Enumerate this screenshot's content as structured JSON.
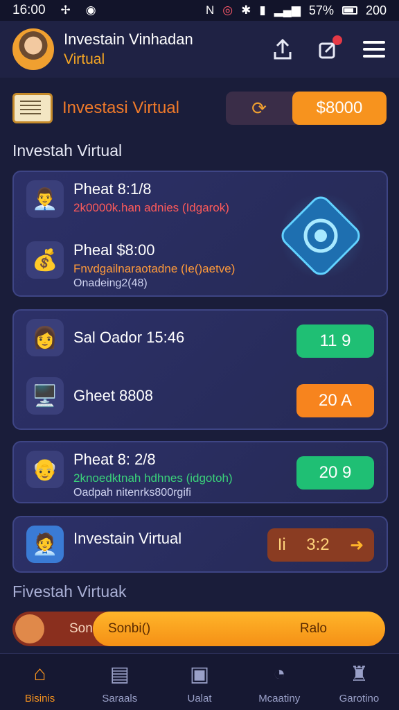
{
  "status_bar": {
    "time": "16:00",
    "battery_text": "57%",
    "right_time": "200"
  },
  "header": {
    "title": "Investain Vinhadan",
    "subtitle": "Virtual"
  },
  "balance": {
    "label": "Investasi Virtual",
    "amount": "$8000"
  },
  "section1": {
    "title": "Investah Virtual"
  },
  "card1": {
    "row1": {
      "title": "Pheat 8:1/8",
      "sub": "2k0000k.han adnies (Idgarok)"
    },
    "row2": {
      "title": "Pheal $8:00",
      "sub": "Fnvdgailnaraotadne (Ie()aetve)",
      "sub2": "Onadeing2(48)"
    }
  },
  "card2": {
    "row1": {
      "title": "Sal Oador 15:46",
      "pill": "11  9"
    },
    "row2": {
      "title": "Gheet 8808",
      "pill": "20  A"
    }
  },
  "card3": {
    "title": "Pheat 8: 2/8",
    "sub": "2knoedktnah hdhnes (idgotoh)",
    "sub2": "Oadpah nitenrks800rgifi",
    "pill": "20  9"
  },
  "card4": {
    "title": "Investain Virtual",
    "pill_left": "Ii",
    "pill_value": "3:2"
  },
  "section2": {
    "title": "Fivestah Virtuak"
  },
  "toggle": {
    "left": "Son",
    "center": "Sonbi()",
    "right": "Ralo"
  },
  "nav": [
    {
      "label": "Bisinis",
      "icon": "home-icon",
      "active": true
    },
    {
      "label": "Saraals",
      "icon": "store-icon",
      "active": false
    },
    {
      "label": "Ualat",
      "icon": "wallet-icon",
      "active": false
    },
    {
      "label": "Mcaatiny",
      "icon": "timer-icon",
      "active": false
    },
    {
      "label": "Garotino",
      "icon": "bell-icon",
      "active": false
    }
  ],
  "colors": {
    "background": "#1a1d3a",
    "accent_orange": "#f7931e",
    "accent_green": "#1fbf74",
    "card": "#2c3068"
  }
}
